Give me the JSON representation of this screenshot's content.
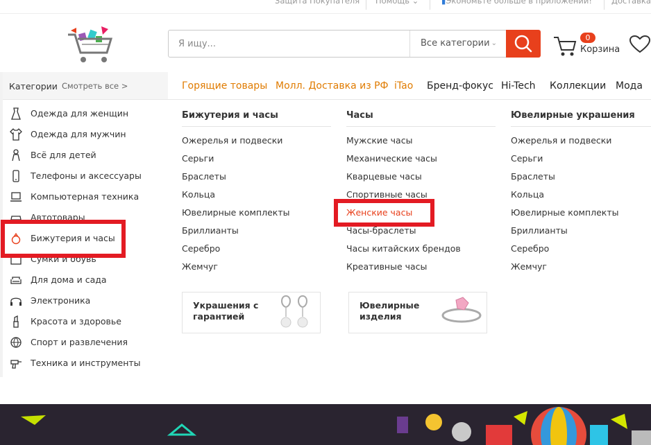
{
  "topbar": {
    "protect": "Защита Покупателя",
    "help": "Помощь",
    "app": "Экономьте больше в приложении!",
    "delivery": "Доставка"
  },
  "search": {
    "placeholder": "Я ищу...",
    "category": "Все категории"
  },
  "cart": {
    "count": "0",
    "label": "Корзина"
  },
  "sidebar": {
    "title": "Категории",
    "see_all": "Смотреть все >",
    "items": [
      {
        "label": "Одежда для женщин",
        "icon": "dress-icon"
      },
      {
        "label": "Одежда для мужчин",
        "icon": "shirt-icon"
      },
      {
        "label": "Всё для детей",
        "icon": "baby-icon"
      },
      {
        "label": "Телефоны и аксессуары",
        "icon": "phone-icon"
      },
      {
        "label": "Компьютерная техника",
        "icon": "laptop-icon"
      },
      {
        "label": "Автотовары",
        "icon": "car-icon"
      },
      {
        "label": "Бижутерия и часы",
        "icon": "ring-icon"
      },
      {
        "label": "Сумки и обувь",
        "icon": "bag-icon"
      },
      {
        "label": "Для дома и сада",
        "icon": "sofa-icon"
      },
      {
        "label": "Электроника",
        "icon": "headphones-icon"
      },
      {
        "label": "Красота и здоровье",
        "icon": "lipstick-icon"
      },
      {
        "label": "Спорт и развлечения",
        "icon": "ball-icon"
      },
      {
        "label": "Техника и инструменты",
        "icon": "drill-icon"
      }
    ]
  },
  "nav": {
    "items": [
      "Горящие товары",
      "Молл. Доставка из РФ",
      "iTao",
      "Бренд-фокус",
      "Hi-Tech",
      "Коллекции",
      "Мода"
    ]
  },
  "flyout": {
    "columns": [
      {
        "title": "Бижутерия и часы",
        "links": [
          "Ожерелья и подвески",
          "Серьги",
          "Браслеты",
          "Кольца",
          "Ювелирные комплекты",
          "Бриллианты",
          "Серебро",
          "Жемчуг"
        ]
      },
      {
        "title": "Часы",
        "links": [
          "Мужские часы",
          "Механические часы",
          "Кварцевые часы",
          "Спортивные часы",
          "Женские часы",
          "Часы-браслеты",
          "Часы китайских брендов",
          "Креативные часы"
        ]
      },
      {
        "title": "Ювелирные украшения",
        "links": [
          "Ожерелья и подвески",
          "Серьги",
          "Браслеты",
          "Кольца",
          "Ювелирные комплекты",
          "Бриллианты",
          "Серебро",
          "Жемчуг"
        ]
      }
    ],
    "promos": [
      {
        "text": "Украшения с\nгарантией",
        "icon": "earrings-icon"
      },
      {
        "text": "Ювелирные\nизделия",
        "icon": "ring-jewel-icon"
      }
    ]
  },
  "colors": {
    "accent": "#e8401c",
    "hot_nav": "#e07b00",
    "annotation": "#e31b23"
  }
}
